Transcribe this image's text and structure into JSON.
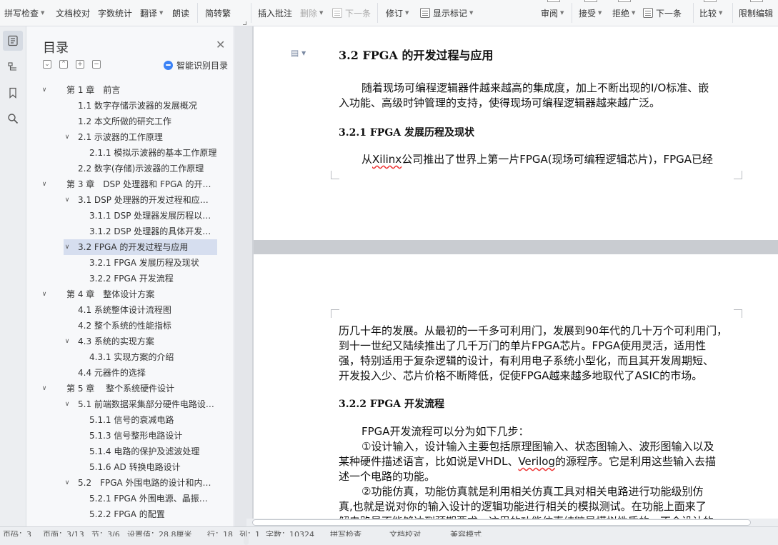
{
  "ribbon": {
    "spellcheck": "拼写检查",
    "doc_proof": "文档校对",
    "word_count": "字数统计",
    "translate": "翻译",
    "read_aloud": "朗读",
    "trad_simp": "简转繁",
    "insert_comment": "插入批注",
    "delete": "删除",
    "next_item": "下一条",
    "revise": "修订",
    "show_marks": "显示标记",
    "review": "审阅",
    "accept": "接受",
    "reject": "拒绝",
    "next": "下一条",
    "compare": "比较",
    "restrict_edit": "限制编辑"
  },
  "toc": {
    "title": "目录",
    "ai_label": "智能识别目录",
    "items": [
      {
        "text": "第 1 章　前言",
        "level": 1,
        "arrow": "down"
      },
      {
        "text": "1.1 数字存储示波器的发展概况",
        "level": 2,
        "arrow": ""
      },
      {
        "text": "1.2 本文所做的研究工作",
        "level": 2,
        "arrow": ""
      },
      {
        "text": "2.1  示波器的工作原理",
        "level": 2,
        "arrow": "down"
      },
      {
        "text": "2.1.1 模拟示波器的基本工作原理",
        "level": 3,
        "arrow": ""
      },
      {
        "text": "2.2  数字(存储)示波器的工作原理",
        "level": 2,
        "arrow": ""
      },
      {
        "text": "第 3 章　DSP 处理器和 FPGA 的开…",
        "level": 1,
        "arrow": "down"
      },
      {
        "text": "3.1 DSP 处理器的开发过程和应…",
        "level": 2,
        "arrow": "down"
      },
      {
        "text": "3.1.1 DSP 处理器发展历程以…",
        "level": 3,
        "arrow": ""
      },
      {
        "text": "3.1.2 DSP 处理器的具体开发…",
        "level": 3,
        "arrow": ""
      },
      {
        "text": "3.2 FPGA 的开发过程与应用",
        "level": 2,
        "arrow": "down",
        "selected": true
      },
      {
        "text": "3.2.1 FPGA 发展历程及现状",
        "level": 3,
        "arrow": ""
      },
      {
        "text": "3.2.2 FPGA 开发流程",
        "level": 3,
        "arrow": ""
      },
      {
        "text": "第 4 章　整体设计方案",
        "level": 1,
        "arrow": "down"
      },
      {
        "text": "4.1 系统整体设计流程图",
        "level": 2,
        "arrow": ""
      },
      {
        "text": "4.2 整个系统的性能指标",
        "level": 2,
        "arrow": ""
      },
      {
        "text": "4.3 系统的实现方案",
        "level": 2,
        "arrow": "down"
      },
      {
        "text": "4.3.1 实现方案的介绍",
        "level": 3,
        "arrow": ""
      },
      {
        "text": "4.4 元器件的选择",
        "level": 2,
        "arrow": ""
      },
      {
        "text": "第 5 章　 整个系统硬件设计",
        "level": 1,
        "arrow": "down"
      },
      {
        "text": "5.1 前端数据采集部分硬件电路设…",
        "level": 2,
        "arrow": "down"
      },
      {
        "text": "5.1.1 信号的衰减电路",
        "level": 3,
        "arrow": ""
      },
      {
        "text": "5.1.3  信号整形电路设计",
        "level": 3,
        "arrow": ""
      },
      {
        "text": "5.1.4  电路的保护及滤波处理",
        "level": 3,
        "arrow": ""
      },
      {
        "text": "5.1.6 AD 转换电路设计",
        "level": 3,
        "arrow": ""
      },
      {
        "text": "5.2　FPGA 外围电路的设计和内…",
        "level": 2,
        "arrow": "down"
      },
      {
        "text": "5.2.1 FPGA 外围电源、晶振…",
        "level": 3,
        "arrow": ""
      },
      {
        "text": "5.2.2 FPGA 的配置",
        "level": 3,
        "arrow": ""
      }
    ]
  },
  "doc": {
    "h_32": "3.2 FPGA 的开发过程与应用",
    "p1_l1": "随着现场可编程逻辑器件越来越高的集成度，加上不断出现的I/O标准、嵌",
    "p1_l2": "入功能、高级时钟管理的支持，使得现场可编程逻辑器越来越广泛。",
    "h_321": "3.2.1 FPGA 发展历程及现状",
    "p2_pre": "从",
    "p2_xilinx": "Xilinx",
    "p2_rest": "公司推出了世界上第一片FPGA(现场可编程逻辑芯片)，FPGA已经",
    "p3_l1": "历几十年的发展。从最初的一千多可利用门，发展到90年代的几十万个可利用门，",
    "p3_l2": "到十一世纪又陆续推出了几千万门的单片FPGA芯片。FPGA使用灵活，适用性",
    "p3_l3": "强，特别适用于复杂逻辑的设计，有利用电子系统小型化，而且其开发周期短、",
    "p3_l4": "开发投入少、芯片价格不断降低，促使FPGA越来越多地取代了ASIC的市场。",
    "h_322": "3.2.2 FPGA 开发流程",
    "p4_l1": "FPGA开发流程可以分为如下几步：",
    "p4_l2": "①设计输入，设计输入主要包括原理图输入、状态图输入、波形图输入以及",
    "p4_l3a": "某种硬件描述语言，比如说是VHDL、",
    "p4_l3b": "Verilog",
    "p4_l3c": "的源程序。它是利用这些输入去描",
    "p4_l4": "述一个电路的功能。",
    "p4_l5": "②功能仿真，功能仿真就是利用相关仿真工具对相关电路进行功能级别仿",
    "p4_l6": "真,也就是说对你的输入设计的逻辑功能进行相关的模拟测试。在功能上面来了",
    "p4_l7": "解电路是否能够达到预期要求，这里的功能仿真纯粹是模拟性质的，不会设计的"
  },
  "status": {
    "page": "页码：3",
    "pages": "页面：3/13",
    "section": "节：3/6",
    "setting": "设置值：28.8厘米",
    "row": "行：18",
    "col": "列：1",
    "words": "字数：10324",
    "spell": "拼写检查",
    "proof": "文档校对",
    "compat": "兼容模式"
  }
}
